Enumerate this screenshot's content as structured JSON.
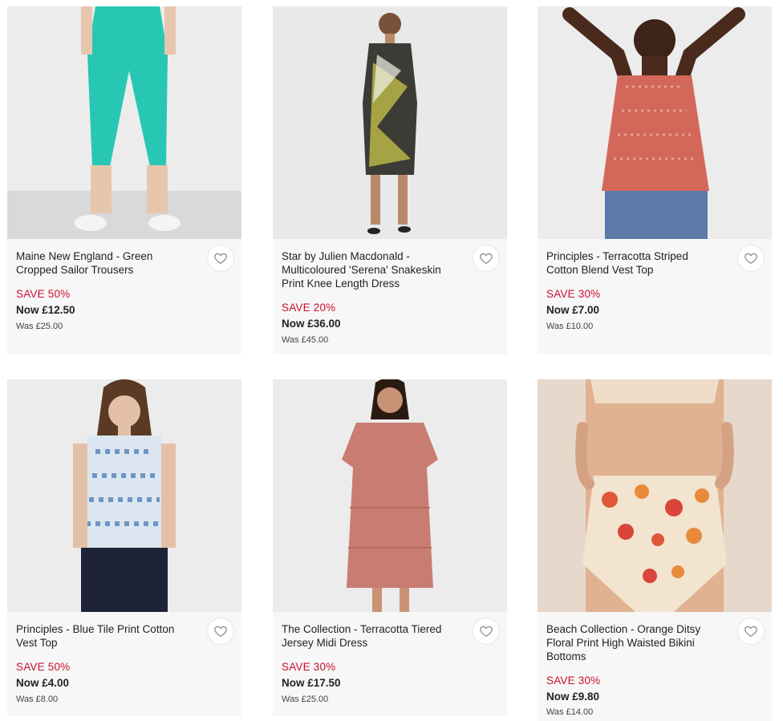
{
  "products": [
    {
      "name": "Maine New England - Green Cropped Sailor Trousers",
      "save": "SAVE 50%",
      "now": "Now £12.50",
      "was": "Was £25.00",
      "wishlist_icon": "heart-outline-icon"
    },
    {
      "name": "Star by Julien Macdonald - Multicoloured 'Serena' Snakeskin Print Knee Length Dress",
      "save": "SAVE 20%",
      "now": "Now £36.00",
      "was": "Was £45.00",
      "wishlist_icon": "heart-outline-icon"
    },
    {
      "name": "Principles - Terracotta Striped Cotton Blend Vest Top",
      "save": "SAVE 30%",
      "now": "Now £7.00",
      "was": "Was £10.00",
      "wishlist_icon": "heart-outline-icon"
    },
    {
      "name": "Principles - Blue Tile Print Cotton Vest Top",
      "save": "SAVE 50%",
      "now": "Now £4.00",
      "was": "Was £8.00",
      "wishlist_icon": "heart-outline-icon"
    },
    {
      "name": "The Collection - Terracotta Tiered Jersey Midi Dress",
      "save": "SAVE 30%",
      "now": "Now £17.50",
      "was": "Was £25.00",
      "wishlist_icon": "heart-outline-icon"
    },
    {
      "name": "Beach Collection - Orange Ditsy Floral Print High Waisted Bikini Bottoms",
      "save": "SAVE 30%",
      "now": "Now £9.80",
      "was": "Was £14.00",
      "wishlist_icon": "heart-outline-icon"
    }
  ],
  "colors": {
    "save_text": "#c8102e",
    "card_background": "#f7f7f7"
  }
}
